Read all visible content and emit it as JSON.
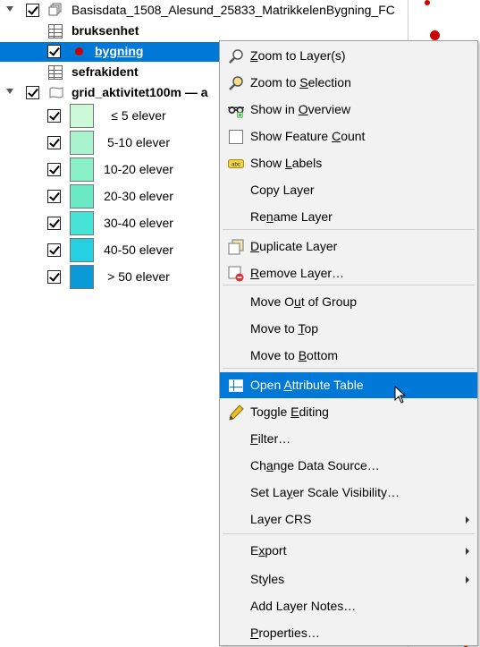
{
  "layer_tree": {
    "group": {
      "label": "Basisdata_1508_Alesund_25833_MatrikkelenBygning_FC"
    },
    "layers": [
      {
        "label": "bruksenhet"
      },
      {
        "label": "bygning",
        "selected": true,
        "marker_color": "#cc0000"
      },
      {
        "label": "sefrakident"
      },
      {
        "label": "grid_aktivitet100m — a"
      }
    ],
    "classes": [
      {
        "label": "≤ 5 elever",
        "color": "#ccfad8"
      },
      {
        "label": "5-10 elever",
        "color": "#a8f3cd"
      },
      {
        "label": "10-20 elever",
        "color": "#88efc6"
      },
      {
        "label": "20-30 elever",
        "color": "#6aeac4"
      },
      {
        "label": "30-40 elever",
        "color": "#47e3d6"
      },
      {
        "label": "40-50 elever",
        "color": "#27cfe3"
      },
      {
        "label": "> 50 elever",
        "color": "#0a9ad8"
      }
    ]
  },
  "context_menu": {
    "items": [
      {
        "pre": "",
        "ul": "Z",
        "post": "oom to Layer(s)",
        "icon": "zoom-layer-icon"
      },
      {
        "pre": "Zoom to ",
        "ul": "S",
        "post": "election",
        "icon": "zoom-selection-icon"
      },
      {
        "pre": "Show in ",
        "ul": "O",
        "post": "verview",
        "icon": "overview-glasses-icon"
      },
      {
        "pre": "Show Feature ",
        "ul": "C",
        "post": "ount",
        "icon": "checkbox-icon"
      },
      {
        "pre": "Show ",
        "ul": "L",
        "post": "abels",
        "icon": "labels-abc-icon"
      },
      {
        "pre": "Copy Layer",
        "ul": "",
        "post": "",
        "icon": ""
      },
      {
        "pre": "Re",
        "ul": "n",
        "post": "ame Layer",
        "icon": ""
      },
      {
        "pre": "",
        "ul": "D",
        "post": "uplicate Layer",
        "icon": "duplicate-layer-icon"
      },
      {
        "pre": "",
        "ul": "R",
        "post": "emove Layer…",
        "icon": "remove-layer-icon"
      },
      {
        "pre": "Move O",
        "ul": "u",
        "post": "t of Group",
        "icon": ""
      },
      {
        "pre": "Move to ",
        "ul": "T",
        "post": "op",
        "icon": ""
      },
      {
        "pre": "Move to ",
        "ul": "B",
        "post": "ottom",
        "icon": ""
      },
      {
        "pre": "Open ",
        "ul": "A",
        "post": "ttribute Table",
        "icon": "attribute-table-icon"
      },
      {
        "pre": "Toggle ",
        "ul": "E",
        "post": "diting",
        "icon": "pencil-icon"
      },
      {
        "pre": "",
        "ul": "F",
        "post": "ilter…",
        "icon": ""
      },
      {
        "pre": "Ch",
        "ul": "a",
        "post": "nge Data Source…",
        "icon": ""
      },
      {
        "pre": "Set La",
        "ul": "y",
        "post": "er Scale Visibility…",
        "icon": ""
      },
      {
        "pre": "Layer CRS",
        "ul": "",
        "post": "",
        "icon": ""
      },
      {
        "pre": "E",
        "ul": "x",
        "post": "port",
        "icon": ""
      },
      {
        "pre": "Styles",
        "ul": "",
        "post": "",
        "icon": ""
      },
      {
        "pre": "Add Layer Notes…",
        "ul": "",
        "post": "",
        "icon": ""
      },
      {
        "pre": "",
        "ul": "P",
        "post": "roperties…",
        "icon": ""
      }
    ]
  }
}
